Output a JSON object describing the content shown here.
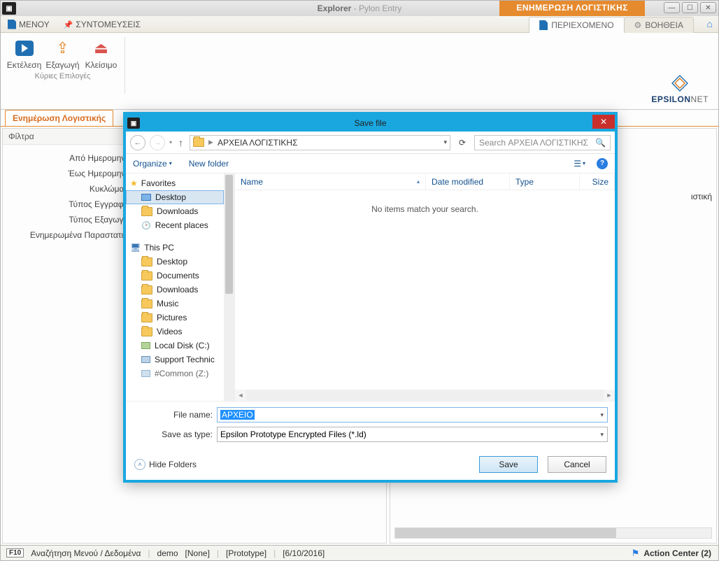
{
  "titlebar": {
    "app_name": "Explorer",
    "sub": " - Pylon Entry",
    "banner": "ΕΝΗΜΕΡΩΣΗ ΛΟΓΙΣΤΙΚΗΣ"
  },
  "menu": {
    "menu": "ΜΕΝΟΥ",
    "shortcuts": "ΣΥΝΤΟΜΕΥΣΕΙΣ",
    "tab_content": "ΠΕΡΙΕΧΟΜΕΝΟ",
    "tab_help": "ΒΟΗΘΕΙΑ"
  },
  "ribbon": {
    "run": "Εκτέλεση",
    "export": "Εξαγωγή",
    "close": "Κλείσιμο",
    "group_label": "Κύριες Επιλογές"
  },
  "logo": {
    "bold": "EPSILON",
    "light": "NET"
  },
  "content_tab": "Ενημέρωση Λογιστικής",
  "filters": {
    "header": "Φίλτρα",
    "from_date": "Από Ημερομηνία",
    "to_date": "Έως Ημερομηνία",
    "circuits": "Κυκλώματα",
    "rec_type": "Τύπος Εγγραφής",
    "exp_type": "Τύπος Εξαγωγής",
    "updated_docs": "Ενημερωμένα Παραστατικά"
  },
  "result_col_tail": "ιστική",
  "dialog": {
    "title": "Save file",
    "breadcrumb": "ΑΡΧΕΙΑ ΛΟΓΙΣΤΙΚΗΣ",
    "search_placeholder": "Search ΑΡΧΕΙΑ ΛΟΓΙΣΤΙΚΗΣ",
    "organize": "Organize",
    "new_folder": "New folder",
    "cols": {
      "name": "Name",
      "date": "Date modified",
      "type": "Type",
      "size": "Size"
    },
    "empty": "No items match your search.",
    "tree": {
      "favorites": "Favorites",
      "desktop": "Desktop",
      "downloads": "Downloads",
      "recent": "Recent places",
      "this_pc": "This PC",
      "pc_desktop": "Desktop",
      "documents": "Documents",
      "pc_downloads": "Downloads",
      "music": "Music",
      "pictures": "Pictures",
      "videos": "Videos",
      "local_c": "Local Disk (C:)",
      "support": "Support Technic",
      "common": "#Common (Z:)"
    },
    "filename_label": "File name:",
    "filename_value": "ΑΡΧΕΙΟ",
    "savetype_label": "Save as type:",
    "savetype_value": "Epsilon Prototype Encrypted Files (*.ld)",
    "hide_folders": "Hide Folders",
    "save": "Save",
    "cancel": "Cancel"
  },
  "status": {
    "f10": "F10",
    "search": "Αναζήτηση Μενού / Δεδομένα",
    "user": "demo",
    "none": "[None]",
    "proto": "[Prototype]",
    "date": "[6/10/2016]",
    "action_center": "Action Center (2)"
  }
}
